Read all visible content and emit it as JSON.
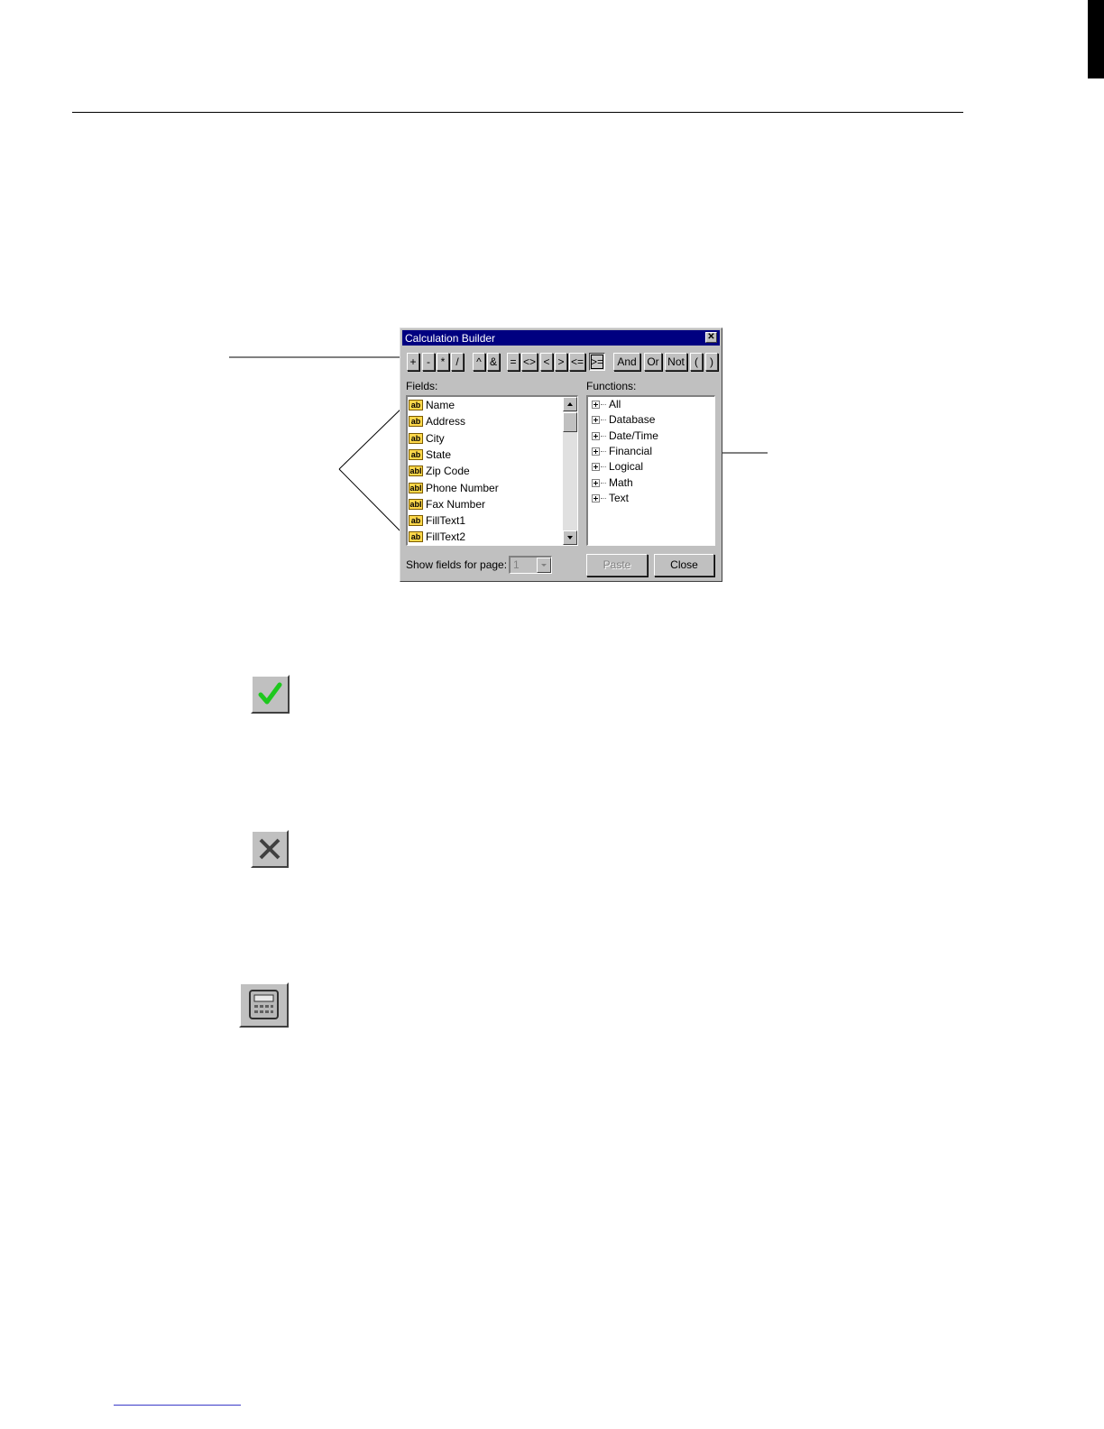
{
  "dialog": {
    "title": "Calculation Builder",
    "close_glyph": "✕",
    "operators": [
      "+",
      "-",
      "*",
      "/",
      "^",
      "&",
      "=",
      "<>",
      "<",
      ">",
      "<=",
      ">=",
      "And",
      "Or",
      "Not",
      "(",
      ")"
    ],
    "pressed_operator": ">=",
    "fields_label": "Fields:",
    "fields": [
      {
        "icon": "ab",
        "label": "Name"
      },
      {
        "icon": "ab",
        "label": "Address"
      },
      {
        "icon": "ab",
        "label": "City"
      },
      {
        "icon": "ab",
        "label": "State"
      },
      {
        "icon": "abl",
        "label": "Zip Code"
      },
      {
        "icon": "abl",
        "label": "Phone Number"
      },
      {
        "icon": "abl",
        "label": "Fax Number"
      },
      {
        "icon": "ab",
        "label": "FillText1"
      },
      {
        "icon": "ab",
        "label": "FillText2"
      }
    ],
    "functions_label": "Functions:",
    "functions": [
      "All",
      "Database",
      "Date/Time",
      "Financial",
      "Logical",
      "Math",
      "Text"
    ],
    "show_fields_label": "Show fields for page:",
    "page_value": "1",
    "paste_label": "Paste",
    "close_label": "Close"
  },
  "icons": {
    "ok": "checkmark-icon",
    "cancel": "x-icon",
    "calc": "calculator-icon"
  },
  "colors": {
    "title_bar": "#000080",
    "dialog_face": "#c0c0c0",
    "field_icon": "#ffd84a",
    "checkmark": "#1ec81e"
  }
}
